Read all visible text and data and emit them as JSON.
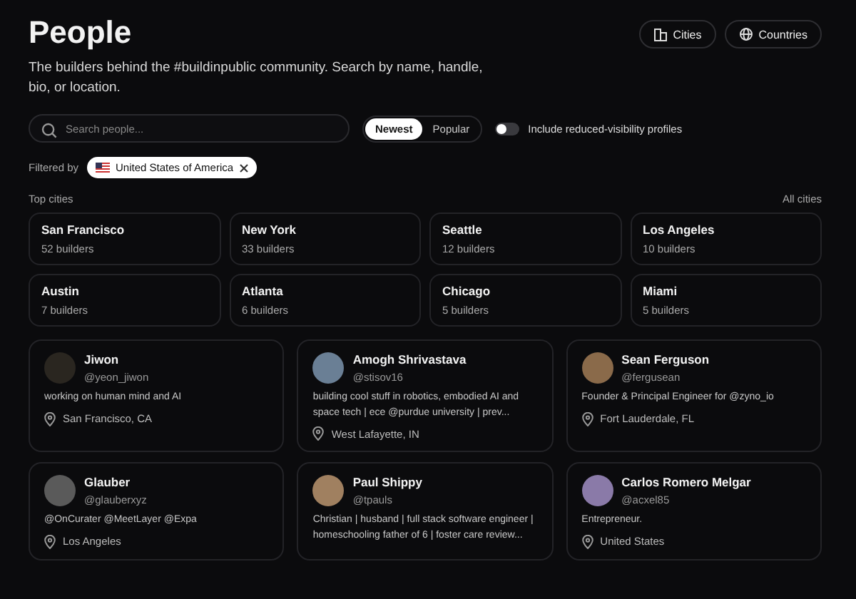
{
  "header": {
    "title": "People",
    "subtitle": "The builders behind the #buildinpublic community. Search by name, handle, bio, or location.",
    "buttons": [
      {
        "kind": "cities",
        "label": "Cities"
      },
      {
        "kind": "countries",
        "label": "Countries"
      }
    ]
  },
  "search": {
    "placeholder": "Search people..."
  },
  "sort": [
    {
      "label": "Newest",
      "selected": true
    },
    {
      "label": "Popular",
      "selected": false
    }
  ],
  "visibility_toggle": {
    "label": "Include reduced-visibility profiles",
    "on": false
  },
  "filter": {
    "label": "Filtered by",
    "chip": "United States of America"
  },
  "top_cities": {
    "title": "Top cities",
    "link": "All cities",
    "cities": [
      {
        "name": "San Francisco",
        "count": "52 builders"
      },
      {
        "name": "New York",
        "count": "33 builders"
      },
      {
        "name": "Seattle",
        "count": "12 builders"
      },
      {
        "name": "Los Angeles",
        "count": "10 builders"
      },
      {
        "name": "Austin",
        "count": "7 builders"
      },
      {
        "name": "Atlanta",
        "count": "6 builders"
      },
      {
        "name": "Chicago",
        "count": "5 builders"
      },
      {
        "name": "Miami",
        "count": "5 builders"
      }
    ]
  },
  "people": [
    {
      "name": "Jiwon",
      "handle": "@yeon_jiwon",
      "bio": "working on human mind and AI",
      "location": "San Francisco, CA",
      "color": "#2a2620"
    },
    {
      "name": "Amogh Shrivastava",
      "handle": "@stisov16",
      "bio": "building cool stuff in robotics, embodied AI and space tech | ece @purdue university | prev...",
      "location": "West Lafayette, IN",
      "color": "#6a7f95"
    },
    {
      "name": "Sean Ferguson",
      "handle": "@fergusean",
      "bio": "Founder & Principal Engineer for @zyno_io",
      "location": "Fort Lauderdale, FL",
      "color": "#8a6a4a"
    },
    {
      "name": "Glauber",
      "handle": "@glauberxyz",
      "bio": "@OnCurater @MeetLayer @Expa",
      "location": "Los Angeles",
      "color": "#5a5a5a"
    },
    {
      "name": "Paul Shippy",
      "handle": "@tpauls",
      "bio": "Christian | husband | full stack software engineer | homeschooling father of 6 | foster care review...",
      "color": "#a08060"
    },
    {
      "name": "Carlos Romero Melgar",
      "handle": "@acxel85",
      "bio": "Entrepreneur.",
      "location": "United States",
      "color": "#8a7aa8"
    }
  ]
}
